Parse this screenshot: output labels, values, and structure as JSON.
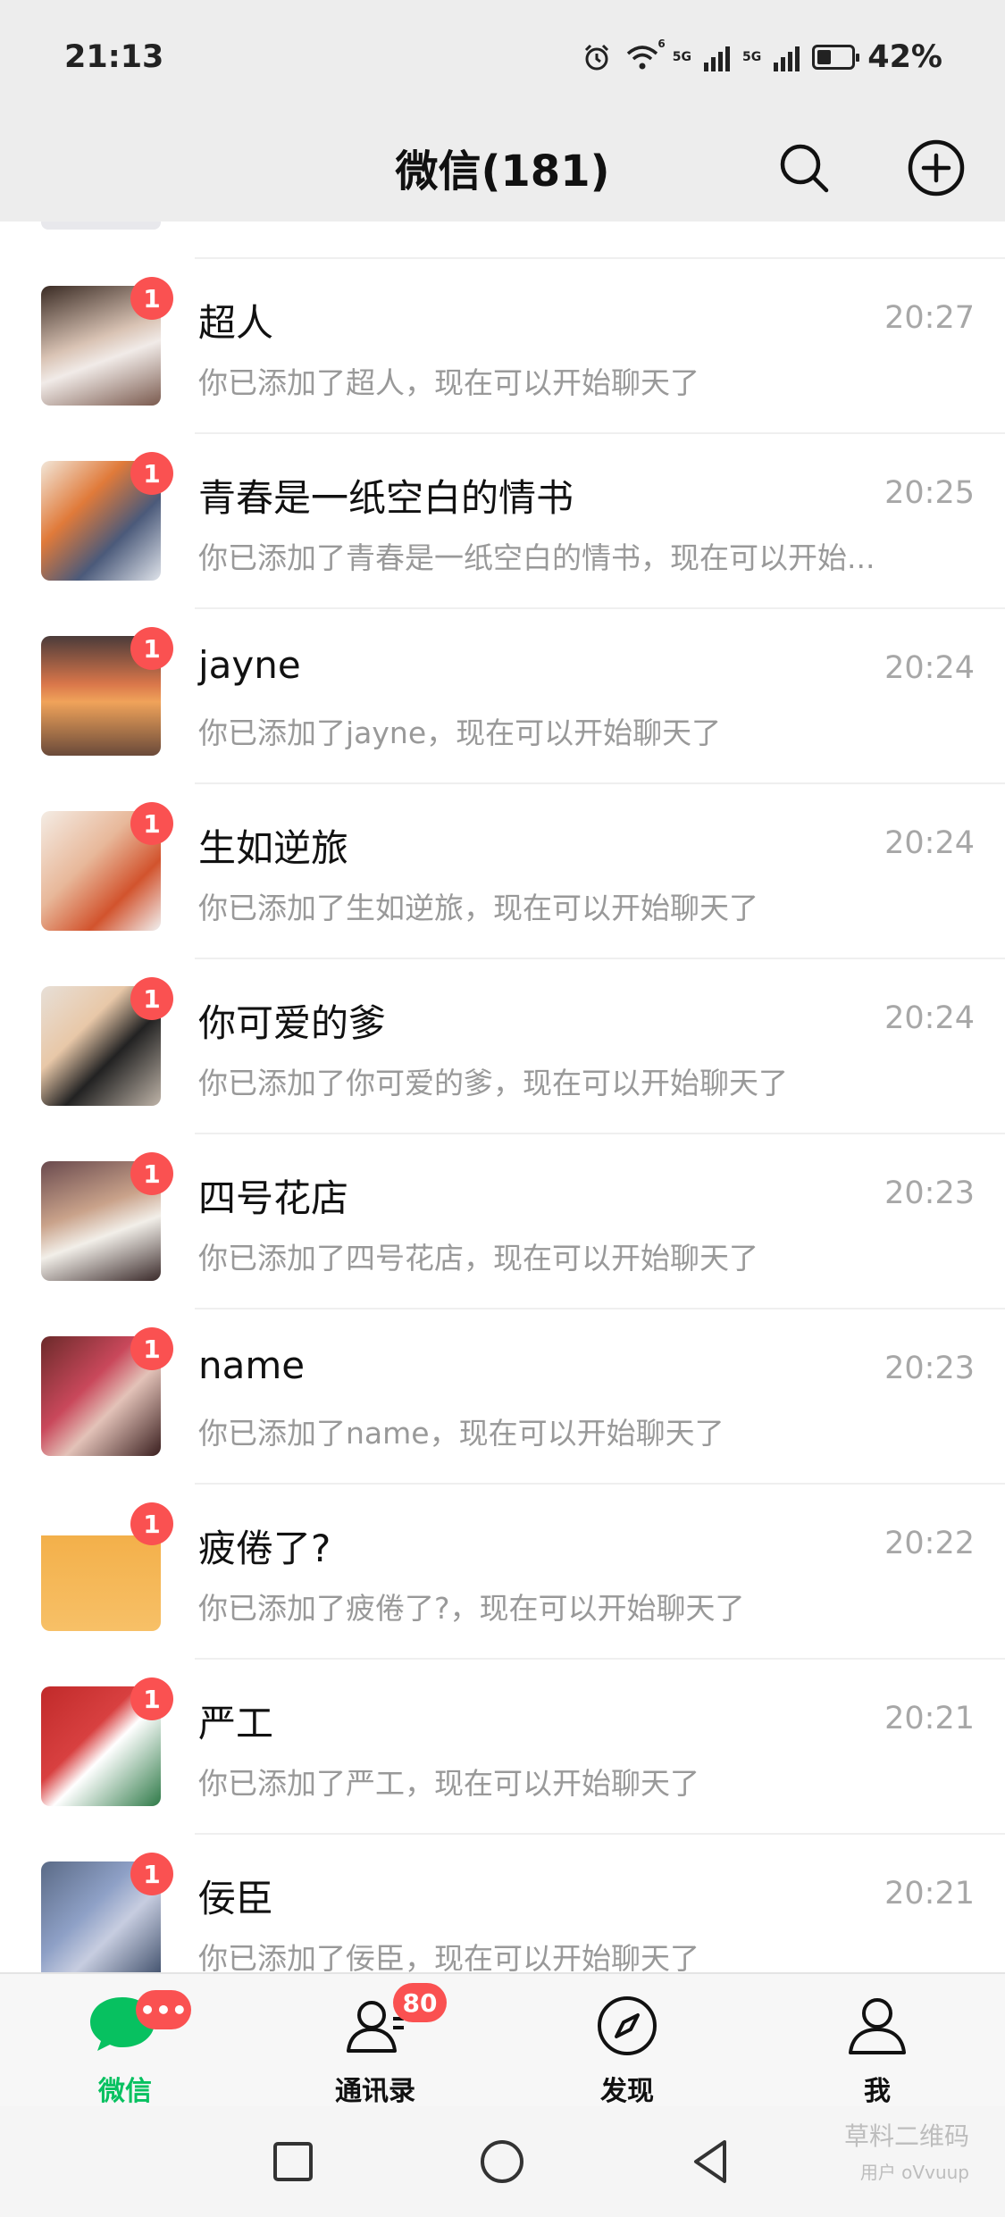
{
  "status_bar": {
    "time": "21:13",
    "net1": "5G",
    "net2": "5G",
    "wifi_tag": "6",
    "battery": "42%",
    "battery_level": 0.42
  },
  "header": {
    "title": "微信(181)"
  },
  "chats": [
    {
      "name": "超人",
      "preview": "你已添加了超人，现在可以开始聊天了",
      "time": "20:27",
      "unread": "1"
    },
    {
      "name": "青春是一纸空白的情书",
      "preview": "你已添加了青春是一纸空白的情书，现在可以开始...",
      "time": "20:25",
      "unread": "1"
    },
    {
      "name": "jayne",
      "preview": "你已添加了jayne，现在可以开始聊天了",
      "time": "20:24",
      "unread": "1"
    },
    {
      "name": "生如逆旅",
      "preview": "你已添加了生如逆旅，现在可以开始聊天了",
      "time": "20:24",
      "unread": "1"
    },
    {
      "name": "你可爱的爹",
      "preview": "你已添加了你可爱的爹，现在可以开始聊天了",
      "time": "20:24",
      "unread": "1"
    },
    {
      "name": "四号花店",
      "preview": "你已添加了四号花店，现在可以开始聊天了",
      "time": "20:23",
      "unread": "1"
    },
    {
      "name": "name",
      "preview": "你已添加了name，现在可以开始聊天了",
      "time": "20:23",
      "unread": "1"
    },
    {
      "name": "疲倦了?",
      "preview": "你已添加了疲倦了?，现在可以开始聊天了",
      "time": "20:22",
      "unread": "1"
    },
    {
      "name": "严工",
      "preview": "你已添加了严工，现在可以开始聊天了",
      "time": "20:21",
      "unread": "1"
    },
    {
      "name": "佞臣",
      "preview": "你已添加了佞臣，现在可以开始聊天了",
      "time": "20:21",
      "unread": "1"
    }
  ],
  "tabs": [
    {
      "label": "微信",
      "badge": "•••",
      "icon": "chat-bubble-icon",
      "active": true
    },
    {
      "label": "通讯录",
      "badge": "80",
      "icon": "contacts-icon",
      "active": false
    },
    {
      "label": "发现",
      "badge": "",
      "icon": "compass-icon",
      "active": false
    },
    {
      "label": "我",
      "badge": "",
      "icon": "person-icon",
      "active": false
    }
  ],
  "watermark": {
    "line1": "草料二维码",
    "line2": "用户 oVvuup"
  },
  "colors": {
    "accent": "#07c160",
    "badge": "#fa5151",
    "header_bg": "#ededed"
  }
}
